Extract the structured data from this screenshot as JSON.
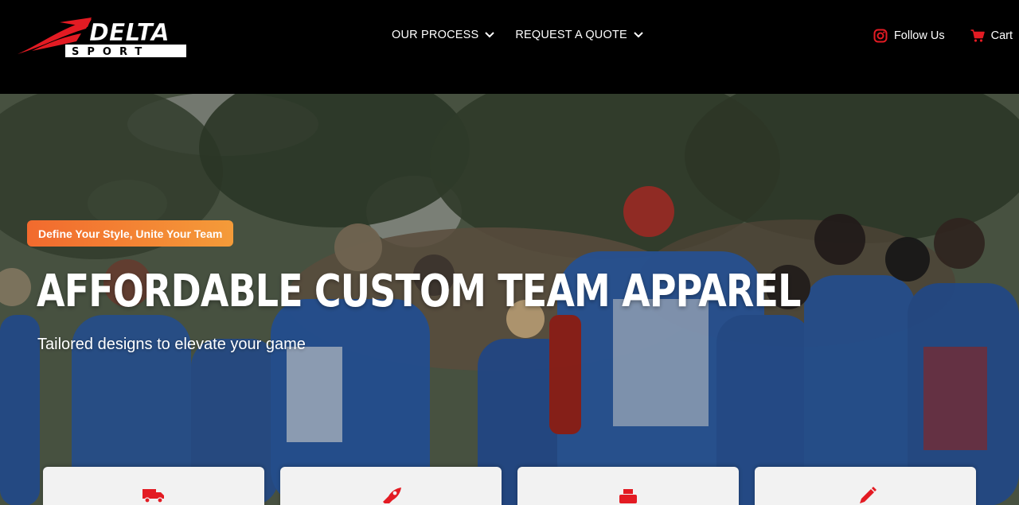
{
  "brand": {
    "logo_text_main": "DELTA",
    "logo_text_sub": "SPORT",
    "accent_color": "#e31b23"
  },
  "nav": {
    "items": [
      {
        "label": "OUR PROCESS",
        "icon": "chevron-down-icon"
      },
      {
        "label": "REQUEST A QUOTE",
        "icon": "chevron-down-icon"
      }
    ]
  },
  "header_right": {
    "follow_label": "Follow Us",
    "follow_icon": "instagram-icon",
    "cart_label": "Cart",
    "cart_icon": "cart-icon"
  },
  "hero": {
    "tagline": "Define Your Style, Unite Your Team",
    "headline": "AFFORDABLE CUSTOM TEAM APPAREL",
    "subhead": "Tailored designs to elevate your game",
    "tagline_gradient": [
      "#f26a2e",
      "#f49b39"
    ]
  },
  "features": [
    {
      "icon": "truck-icon"
    },
    {
      "icon": "rocket-icon"
    },
    {
      "icon": "printer-icon"
    },
    {
      "icon": "pencil-icon"
    }
  ]
}
